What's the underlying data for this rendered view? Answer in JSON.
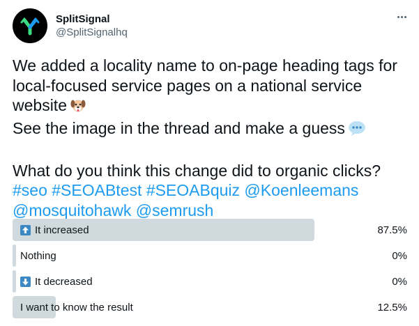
{
  "author": {
    "display_name": "SplitSignal",
    "handle": "@SplitSignalhq",
    "avatar_icon": "splitsignal-logo-icon",
    "avatar_colors": {
      "background": "#000000",
      "green": "#3ddc84",
      "blue": "#1d9bf0"
    }
  },
  "menu": {
    "icon": "more-options-icon"
  },
  "tweet": {
    "line1": "We added a locality name to on-page heading tags for",
    "line2": "local-focused service pages on a national service",
    "line3": "website",
    "line3_emoji": "dog-face-emoji",
    "line4": "See the image in the thread and make a guess",
    "line4_emoji": "speech-balloon-emoji",
    "line5": "What do you think this change did to organic clicks?",
    "tags_line1": [
      "#seo",
      "#SEOABtest",
      "#SEOABquiz",
      "@Koenleemans"
    ],
    "tags_line2": [
      "@mosquitohawk",
      "@semrush"
    ],
    "link_color": "#1d9bf0"
  },
  "poll": {
    "options": [
      {
        "label": "It increased",
        "icon": "up-arrow-icon",
        "percent": "87.5%",
        "fraction": 0.875,
        "leading": true
      },
      {
        "label": "Nothing",
        "icon": "",
        "percent": "0%",
        "fraction": 0.0,
        "leading": false
      },
      {
        "label": "It decreased",
        "icon": "down-arrow-icon",
        "percent": "0%",
        "fraction": 0.0,
        "leading": false
      },
      {
        "label": "I want to know the result",
        "icon": "",
        "percent": "12.5%",
        "fraction": 0.125,
        "leading": false
      }
    ],
    "bar_color": "#cfd9de",
    "icon_color": "#3b88c3"
  }
}
